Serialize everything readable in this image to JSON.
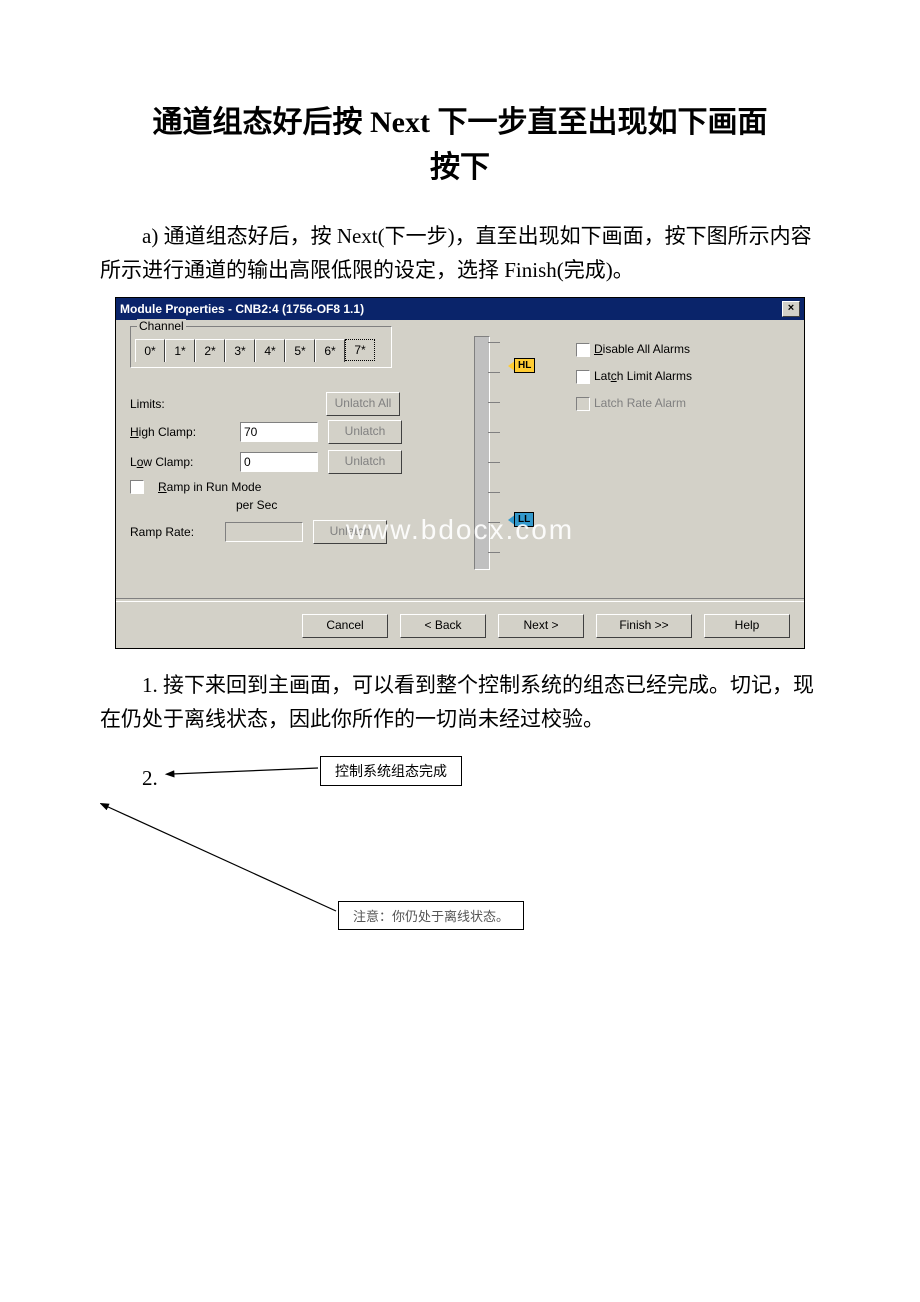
{
  "title_line1": "通道组态好后按 Next 下一步直至出现如下画面",
  "title_line2": "按下",
  "para_a": "a) 通道组态好后，按 Next(下一步)，直至出现如下画面，按下图所示内容所示进行通道的输出高限低限的设定，选择 Finish(完成)。",
  "dialog": {
    "title": "Module Properties - CNB2:4 (1756-OF8 1.1)",
    "close": "×",
    "group_label": "Channel",
    "tabs": [
      "0*",
      "1*",
      "2*",
      "3*",
      "4*",
      "5*",
      "6*",
      "7*"
    ],
    "tab_selected_index": 7,
    "limits_label": "Limits:",
    "unlatch_all": "Unlatch All",
    "high_clamp_label": "High Clamp:",
    "high_clamp_value": "70",
    "low_clamp_label": "Low Clamp:",
    "low_clamp_value": "0",
    "unlatch": "Unlatch",
    "ramp_label": "Ramp in Run Mode",
    "per_sec": "per Sec",
    "ramp_rate_label": "Ramp Rate:",
    "disable_all": "Disable All Alarms",
    "latch_limit": "Latch Limit Alarms",
    "latch_rate": "Latch Rate Alarm",
    "hl": "HL",
    "ll": "LL",
    "cancel": "Cancel",
    "back": "< Back",
    "next": "Next >",
    "finish": "Finish >>",
    "help": "Help",
    "watermark": "www.bdocx.com"
  },
  "para_1": "1. 接下来回到主画面，可以看到整个控制系统的组态已经完成。切记，现在仍处于离线状态，因此你所作的一切尚未经过校验。",
  "num2": "2.",
  "callout1": "控制系统组态完成",
  "callout2": "注意：你仍处于离线状态。"
}
